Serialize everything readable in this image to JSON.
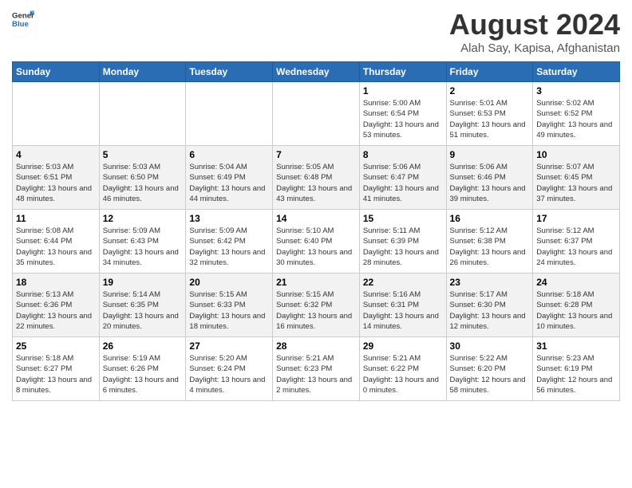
{
  "logo": {
    "general": "General",
    "blue": "Blue"
  },
  "title": "August 2024",
  "location": "Alah Say, Kapisa, Afghanistan",
  "days_header": [
    "Sunday",
    "Monday",
    "Tuesday",
    "Wednesday",
    "Thursday",
    "Friday",
    "Saturday"
  ],
  "weeks": [
    [
      {
        "day": "",
        "sunrise": "",
        "sunset": "",
        "daylight": ""
      },
      {
        "day": "",
        "sunrise": "",
        "sunset": "",
        "daylight": ""
      },
      {
        "day": "",
        "sunrise": "",
        "sunset": "",
        "daylight": ""
      },
      {
        "day": "",
        "sunrise": "",
        "sunset": "",
        "daylight": ""
      },
      {
        "day": "1",
        "sunrise": "Sunrise: 5:00 AM",
        "sunset": "Sunset: 6:54 PM",
        "daylight": "Daylight: 13 hours and 53 minutes."
      },
      {
        "day": "2",
        "sunrise": "Sunrise: 5:01 AM",
        "sunset": "Sunset: 6:53 PM",
        "daylight": "Daylight: 13 hours and 51 minutes."
      },
      {
        "day": "3",
        "sunrise": "Sunrise: 5:02 AM",
        "sunset": "Sunset: 6:52 PM",
        "daylight": "Daylight: 13 hours and 49 minutes."
      }
    ],
    [
      {
        "day": "4",
        "sunrise": "Sunrise: 5:03 AM",
        "sunset": "Sunset: 6:51 PM",
        "daylight": "Daylight: 13 hours and 48 minutes."
      },
      {
        "day": "5",
        "sunrise": "Sunrise: 5:03 AM",
        "sunset": "Sunset: 6:50 PM",
        "daylight": "Daylight: 13 hours and 46 minutes."
      },
      {
        "day": "6",
        "sunrise": "Sunrise: 5:04 AM",
        "sunset": "Sunset: 6:49 PM",
        "daylight": "Daylight: 13 hours and 44 minutes."
      },
      {
        "day": "7",
        "sunrise": "Sunrise: 5:05 AM",
        "sunset": "Sunset: 6:48 PM",
        "daylight": "Daylight: 13 hours and 43 minutes."
      },
      {
        "day": "8",
        "sunrise": "Sunrise: 5:06 AM",
        "sunset": "Sunset: 6:47 PM",
        "daylight": "Daylight: 13 hours and 41 minutes."
      },
      {
        "day": "9",
        "sunrise": "Sunrise: 5:06 AM",
        "sunset": "Sunset: 6:46 PM",
        "daylight": "Daylight: 13 hours and 39 minutes."
      },
      {
        "day": "10",
        "sunrise": "Sunrise: 5:07 AM",
        "sunset": "Sunset: 6:45 PM",
        "daylight": "Daylight: 13 hours and 37 minutes."
      }
    ],
    [
      {
        "day": "11",
        "sunrise": "Sunrise: 5:08 AM",
        "sunset": "Sunset: 6:44 PM",
        "daylight": "Daylight: 13 hours and 35 minutes."
      },
      {
        "day": "12",
        "sunrise": "Sunrise: 5:09 AM",
        "sunset": "Sunset: 6:43 PM",
        "daylight": "Daylight: 13 hours and 34 minutes."
      },
      {
        "day": "13",
        "sunrise": "Sunrise: 5:09 AM",
        "sunset": "Sunset: 6:42 PM",
        "daylight": "Daylight: 13 hours and 32 minutes."
      },
      {
        "day": "14",
        "sunrise": "Sunrise: 5:10 AM",
        "sunset": "Sunset: 6:40 PM",
        "daylight": "Daylight: 13 hours and 30 minutes."
      },
      {
        "day": "15",
        "sunrise": "Sunrise: 5:11 AM",
        "sunset": "Sunset: 6:39 PM",
        "daylight": "Daylight: 13 hours and 28 minutes."
      },
      {
        "day": "16",
        "sunrise": "Sunrise: 5:12 AM",
        "sunset": "Sunset: 6:38 PM",
        "daylight": "Daylight: 13 hours and 26 minutes."
      },
      {
        "day": "17",
        "sunrise": "Sunrise: 5:12 AM",
        "sunset": "Sunset: 6:37 PM",
        "daylight": "Daylight: 13 hours and 24 minutes."
      }
    ],
    [
      {
        "day": "18",
        "sunrise": "Sunrise: 5:13 AM",
        "sunset": "Sunset: 6:36 PM",
        "daylight": "Daylight: 13 hours and 22 minutes."
      },
      {
        "day": "19",
        "sunrise": "Sunrise: 5:14 AM",
        "sunset": "Sunset: 6:35 PM",
        "daylight": "Daylight: 13 hours and 20 minutes."
      },
      {
        "day": "20",
        "sunrise": "Sunrise: 5:15 AM",
        "sunset": "Sunset: 6:33 PM",
        "daylight": "Daylight: 13 hours and 18 minutes."
      },
      {
        "day": "21",
        "sunrise": "Sunrise: 5:15 AM",
        "sunset": "Sunset: 6:32 PM",
        "daylight": "Daylight: 13 hours and 16 minutes."
      },
      {
        "day": "22",
        "sunrise": "Sunrise: 5:16 AM",
        "sunset": "Sunset: 6:31 PM",
        "daylight": "Daylight: 13 hours and 14 minutes."
      },
      {
        "day": "23",
        "sunrise": "Sunrise: 5:17 AM",
        "sunset": "Sunset: 6:30 PM",
        "daylight": "Daylight: 13 hours and 12 minutes."
      },
      {
        "day": "24",
        "sunrise": "Sunrise: 5:18 AM",
        "sunset": "Sunset: 6:28 PM",
        "daylight": "Daylight: 13 hours and 10 minutes."
      }
    ],
    [
      {
        "day": "25",
        "sunrise": "Sunrise: 5:18 AM",
        "sunset": "Sunset: 6:27 PM",
        "daylight": "Daylight: 13 hours and 8 minutes."
      },
      {
        "day": "26",
        "sunrise": "Sunrise: 5:19 AM",
        "sunset": "Sunset: 6:26 PM",
        "daylight": "Daylight: 13 hours and 6 minutes."
      },
      {
        "day": "27",
        "sunrise": "Sunrise: 5:20 AM",
        "sunset": "Sunset: 6:24 PM",
        "daylight": "Daylight: 13 hours and 4 minutes."
      },
      {
        "day": "28",
        "sunrise": "Sunrise: 5:21 AM",
        "sunset": "Sunset: 6:23 PM",
        "daylight": "Daylight: 13 hours and 2 minutes."
      },
      {
        "day": "29",
        "sunrise": "Sunrise: 5:21 AM",
        "sunset": "Sunset: 6:22 PM",
        "daylight": "Daylight: 13 hours and 0 minutes."
      },
      {
        "day": "30",
        "sunrise": "Sunrise: 5:22 AM",
        "sunset": "Sunset: 6:20 PM",
        "daylight": "Daylight: 12 hours and 58 minutes."
      },
      {
        "day": "31",
        "sunrise": "Sunrise: 5:23 AM",
        "sunset": "Sunset: 6:19 PM",
        "daylight": "Daylight: 12 hours and 56 minutes."
      }
    ]
  ]
}
